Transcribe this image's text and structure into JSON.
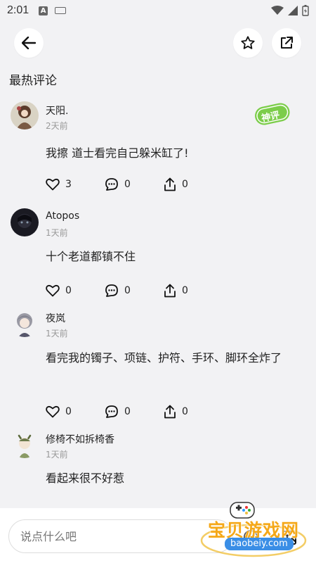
{
  "status_bar": {
    "time": "2:01",
    "notif_letter": "A"
  },
  "header": {
    "section_title": "最热评论"
  },
  "comments": [
    {
      "username": "天阳.",
      "time": "2天前",
      "text": "我擦 道士看完自己躲米缸了!",
      "likes": "3",
      "replies": "0",
      "shares": "0",
      "badge": "神评"
    },
    {
      "username": "Atopos",
      "time": "1天前",
      "text": "十个老道都镇不住",
      "likes": "0",
      "replies": "0",
      "shares": "0"
    },
    {
      "username": "夜岚",
      "time": "1天前",
      "text": "看完我的镯子、项链、护符、手环、脚环全炸了",
      "likes": "0",
      "replies": "0",
      "shares": "0"
    },
    {
      "username": "修椅不如拆椅香",
      "time": "1天前",
      "text": "看起来很不好惹"
    }
  ],
  "composer": {
    "placeholder": "说点什么吧"
  },
  "watermark": {
    "title": "宝贝游戏网",
    "url": "baobeiy.com"
  }
}
